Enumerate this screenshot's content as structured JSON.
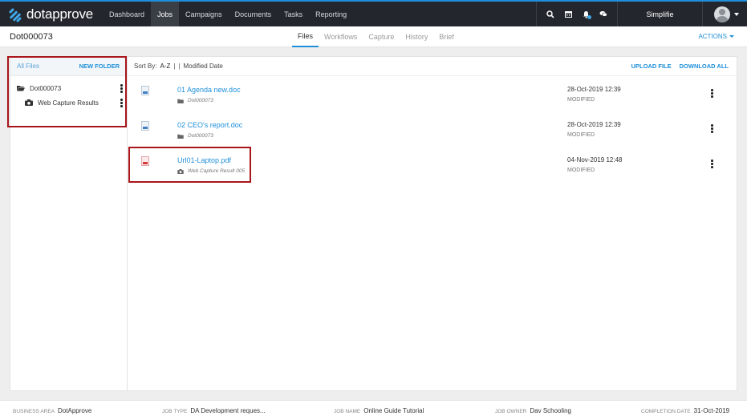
{
  "app": {
    "logo_text": "dotapprove",
    "nav": [
      "Dashboard",
      "Jobs",
      "Campaigns",
      "Documents",
      "Tasks",
      "Reporting"
    ],
    "active_nav": "Jobs",
    "icons": [
      "search-icon",
      "calendar-icon",
      "bell-icon",
      "chat-icon"
    ],
    "user_name": "Simplifie",
    "accent": "#1f8fd9"
  },
  "subheader": {
    "job_title": "Dot000073",
    "tabs": [
      "Files",
      "Workflows",
      "Capture",
      "History",
      "Brief"
    ],
    "active_tab": "Files",
    "actions_label": "ACTIONS"
  },
  "left": {
    "all_files": "All Files",
    "new_folder": "NEW FOLDER",
    "tree": [
      {
        "label": "Dot000073",
        "icon": "folder-open-icon"
      },
      {
        "label": "Web Capture Results",
        "icon": "camera-icon"
      }
    ]
  },
  "toolbar": {
    "sort_by": "Sort By:",
    "sort_az": "A-Z",
    "sep1": "|",
    "sep2": "|",
    "sort_modified": "Modified Date",
    "upload": "UPLOAD FILE",
    "download": "DOWNLOAD ALL"
  },
  "files": [
    {
      "name": "01 Agenda new.doc",
      "location": "Dot000073",
      "location_icon": "folder-icon",
      "type": "doc",
      "date": "28-Oct-2019 12:39",
      "status": "MODIFIED"
    },
    {
      "name": "02 CEO's report.doc",
      "location": "Dot000073",
      "location_icon": "folder-icon",
      "type": "doc",
      "date": "28-Oct-2019 12:39",
      "status": "MODIFIED"
    },
    {
      "name": "Url01-Laptop.pdf",
      "location": "Web Capture Result 005",
      "location_icon": "camera-icon",
      "type": "pdf",
      "date": "04-Nov-2019 12:48",
      "status": "MODIFIED"
    }
  ],
  "footer": {
    "business_area_label": "BUSINESS AREA",
    "business_area": "DotApprove",
    "job_type_label": "JOB TYPE",
    "job_type": "DA Development reques...",
    "job_name_label": "JOB NAME",
    "job_name": "Online Guide Tutorial",
    "job_owner_label": "JOB OWNER",
    "job_owner": "Dav Schooling",
    "completion_label": "COMPLETION DATE",
    "completion_date": "31-Oct-2019"
  }
}
